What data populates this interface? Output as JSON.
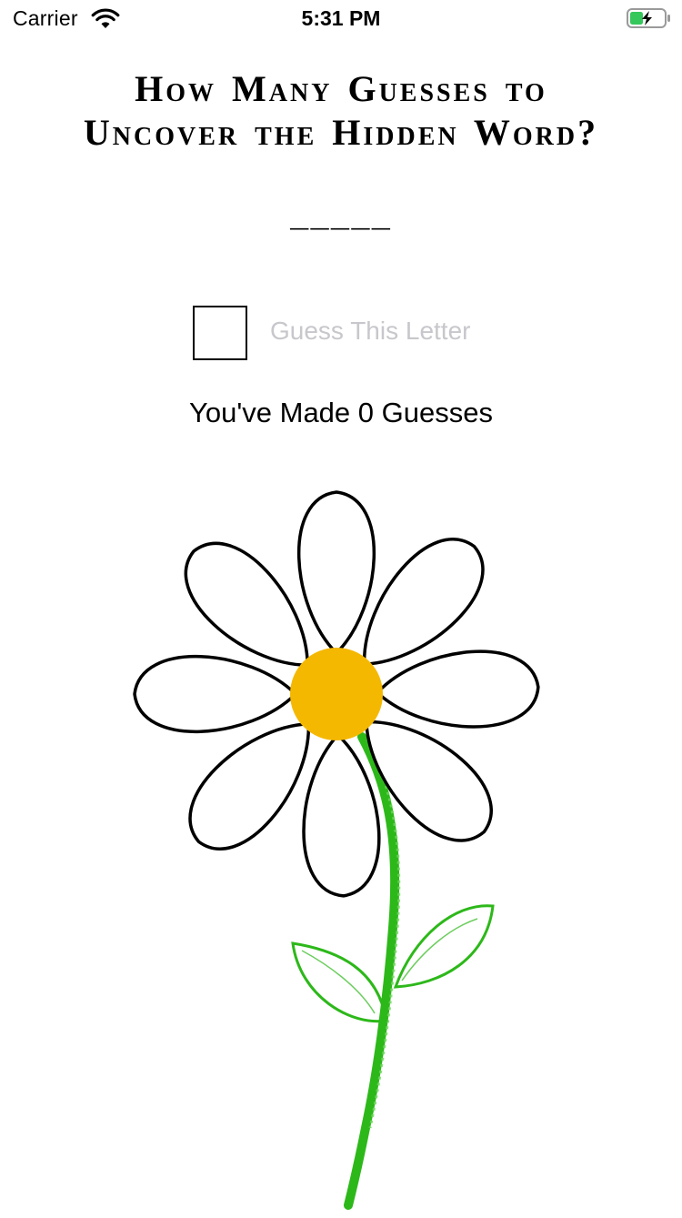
{
  "status_bar": {
    "carrier": "Carrier",
    "time": "5:31 PM",
    "wifi_icon": "wifi-icon",
    "battery_icon": "battery-charging-icon"
  },
  "title": {
    "line1": "How Many Guesses to",
    "line2": "Uncover the Hidden Word?"
  },
  "word": {
    "mask": "_____"
  },
  "guess": {
    "input_value": "",
    "button_label": "Guess This Letter"
  },
  "counter": {
    "text": "You've Made 0 Guesses"
  },
  "flower": {
    "image": "daisy-flower",
    "petal_count": 8,
    "center_color": "#f5b800",
    "stem_color": "#2db81a"
  },
  "colors": {
    "button_disabled": "#c7c7cc",
    "battery_green": "#35c759"
  }
}
